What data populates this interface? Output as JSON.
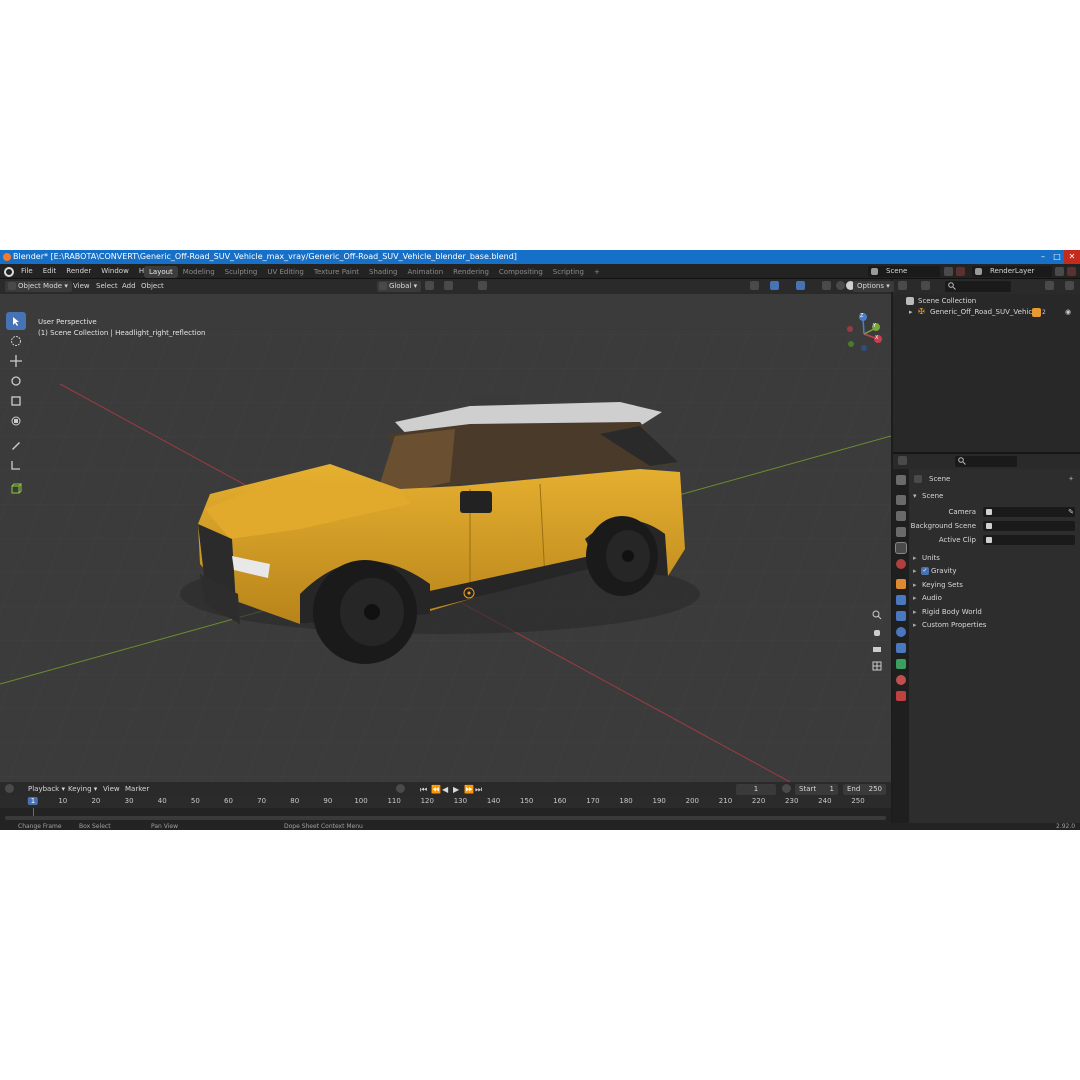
{
  "window": {
    "title": "Blender* [E:\\RABOTA\\CONVERT\\Generic_Off-Road_SUV_Vehicle_max_vray/Generic_Off-Road_SUV_Vehicle_blender_base.blend]"
  },
  "menu": [
    "File",
    "Edit",
    "Render",
    "Window",
    "Help"
  ],
  "workspaces": [
    {
      "label": "Layout",
      "active": true
    },
    {
      "label": "Modeling"
    },
    {
      "label": "Sculpting"
    },
    {
      "label": "UV Editing"
    },
    {
      "label": "Texture Paint"
    },
    {
      "label": "Shading"
    },
    {
      "label": "Animation"
    },
    {
      "label": "Rendering"
    },
    {
      "label": "Compositing"
    },
    {
      "label": "Scripting"
    }
  ],
  "add_workspace": "+",
  "scene_selector": "Scene",
  "view_layer": "RenderLayer",
  "viewport_header": {
    "mode": "Object Mode",
    "menus": [
      "View",
      "Select",
      "Add",
      "Object"
    ],
    "orientation": "Global",
    "options": "Options"
  },
  "viewport": {
    "perspective": "User Perspective",
    "collection_info": "(1) Scene Collection | Headlight_right_reflection",
    "gizmo_axes": {
      "x": "X",
      "y": "Y",
      "z": "Z"
    }
  },
  "outliner": {
    "root": "Scene Collection",
    "items": [
      "Generic_Off_Road_SUV_Vehicle"
    ],
    "item_badge": "2"
  },
  "properties": {
    "breadcrumb": "Scene",
    "panel_title": "Scene",
    "fields": [
      {
        "label": "Camera",
        "value": ""
      },
      {
        "label": "Background Scene",
        "value": ""
      },
      {
        "label": "Active Clip",
        "value": ""
      }
    ],
    "sections": [
      {
        "label": "Units",
        "checkbox": false
      },
      {
        "label": "Gravity",
        "checkbox": true
      },
      {
        "label": "Keying Sets",
        "checkbox": false
      },
      {
        "label": "Audio",
        "checkbox": false
      },
      {
        "label": "Rigid Body World",
        "checkbox": false
      },
      {
        "label": "Custom Properties",
        "checkbox": false
      }
    ]
  },
  "timeline": {
    "menus": [
      "Playback",
      "Keying",
      "View",
      "Marker"
    ],
    "current_frame": "1",
    "start_label": "Start",
    "start": "1",
    "end_label": "End",
    "end": "250",
    "ticks": [
      "1",
      "10",
      "20",
      "30",
      "40",
      "50",
      "60",
      "70",
      "80",
      "90",
      "100",
      "110",
      "120",
      "130",
      "140",
      "150",
      "160",
      "170",
      "180",
      "190",
      "200",
      "210",
      "220",
      "230",
      "240",
      "250"
    ]
  },
  "statusbar": {
    "left_action": "Change Frame",
    "middle_action": "Box Select",
    "right_action": "Pan View",
    "context_menu": "Dope Sheet Context Menu",
    "version": "2.92.0"
  },
  "colors": {
    "accent": "#4772b3",
    "titlebar": "#1670c8",
    "car_body": "#d9a020",
    "viewport_bg": "#3b3b3b"
  }
}
